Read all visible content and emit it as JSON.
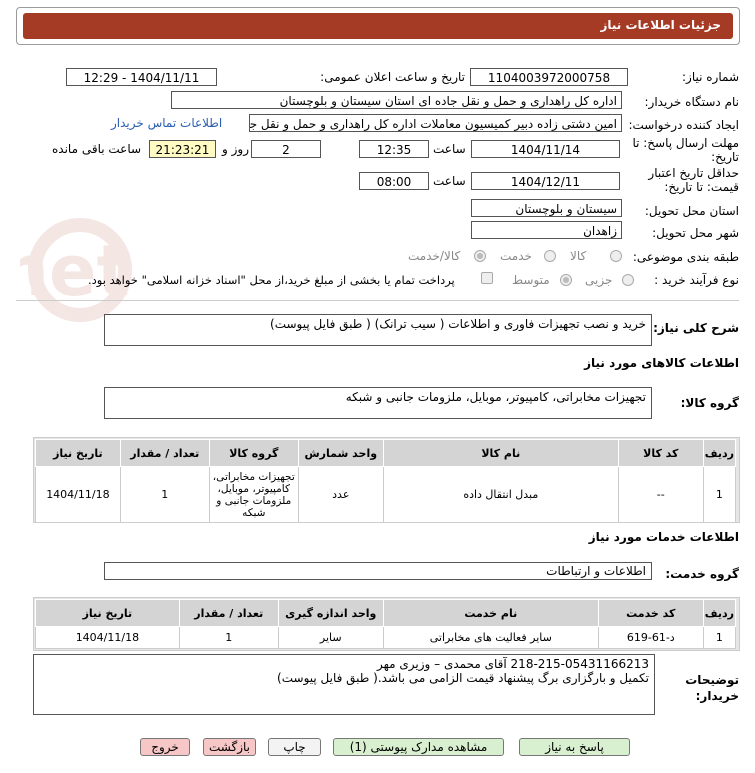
{
  "header": {
    "title": "جزئیات اطلاعات نیاز"
  },
  "fields": {
    "need_number_label": "شماره نیاز:",
    "need_number": "1104003972000758",
    "announce_label": "تاریخ و ساعت اعلان عمومی:",
    "announce_value": "1404/11/11 - 12:29",
    "buyer_org_label": "نام دستگاه خریدار:",
    "buyer_org": "اداره کل راهداری و حمل و نقل جاده ای استان سیستان و بلوچستان",
    "creator_label": "ایجاد کننده درخواست:",
    "creator": "امین دشتی زاده دبیر کمیسیون معاملات اداره کل راهداری و حمل و نقل جاده ای",
    "contact_link": "اطلاعات تماس خریدار",
    "deadline_label": "مهلت ارسال پاسخ: تا تاریخ:",
    "deadline_date": "1404/11/14",
    "time_label": "ساعت",
    "deadline_time": "12:35",
    "days": "2",
    "days_label": "روز و",
    "remaining": "21:23:21",
    "remaining_label": "ساعت باقی مانده",
    "validity_label": "حداقل تاریخ اعتبار قیمت: تا تاریخ:",
    "validity_date": "1404/12/11",
    "validity_time_label": "ساعت",
    "validity_time": "08:00",
    "province_label": "استان محل تحویل:",
    "province": "سیستان و بلوچستان",
    "city_label": "شهر محل تحویل:",
    "city": "زاهدان",
    "category_label": "طبقه بندی موضوعی:",
    "category_options": [
      "کالا",
      "خدمت",
      "کالا/خدمت"
    ],
    "process_label": "نوع فرآیند خرید :",
    "process_options": [
      "جزیی",
      "متوسط"
    ],
    "payment_note": "پرداخت تمام یا بخشی از مبلغ خرید،از محل \"اسناد خزانه اسلامی\" خواهد بود."
  },
  "need_desc": {
    "label": "شرح کلی نیاز:",
    "text": "خرید و نصب تجهیزات فاوری و اطلاعات ( سیب ترانک) ( طبق فایل پیوست)"
  },
  "goods": {
    "section_title": "اطلاعات کالاهای مورد نیاز",
    "group_label": "گروه کالا:",
    "group_value": "تجهیزات مخابراتی، کامپیوتر، موبایل، ملزومات جانبی و شبکه",
    "columns": [
      "ردیف",
      "کد کالا",
      "نام کالا",
      "واحد شمارش",
      "گروه کالا",
      "تعداد / مقدار",
      "تاریخ نیاز"
    ],
    "rows": [
      {
        "row": "1",
        "code": "--",
        "name": "مبدل انتقال داده",
        "unit": "عدد",
        "group": "تجهیزات مخابراتی، کامپیوتر، موبایل، ملزومات جانبی و شبکه",
        "qty": "1",
        "date": "1404/11/18"
      }
    ]
  },
  "services": {
    "section_title": "اطلاعات خدمات مورد نیاز",
    "group_label": "گروه خدمت:",
    "group_value": "اطلاعات و ارتباطات",
    "columns": [
      "ردیف",
      "کد خدمت",
      "نام خدمت",
      "واحد اندازه گیری",
      "تعداد / مقدار",
      "تاریخ نیاز"
    ],
    "rows": [
      {
        "row": "1",
        "code": "د-61-619",
        "name": "سایر فعالیت های مخابراتی",
        "unit": "سایر",
        "qty": "1",
        "date": "1404/11/18"
      }
    ]
  },
  "buyer_notes": {
    "label": "توضیحات خریدار:",
    "line1": "218-215-05431166213  آقای محمدی – وزیری مهر",
    "line2": "تکمیل و بارگزاری برگ پیشنهاد قیمت الزامی می باشد.( طبق فایل پیوست)"
  },
  "buttons": {
    "reply": "پاسخ به نیاز",
    "view_docs": "مشاهده مدارک پیوستی (1)",
    "print": "چاپ",
    "back": "بازگشت",
    "exit": "خروج"
  },
  "watermark": "AriaTender.net"
}
